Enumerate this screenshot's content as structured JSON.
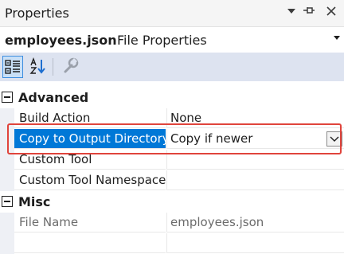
{
  "window": {
    "title": "Properties"
  },
  "object": {
    "name": "employees.json",
    "kind": "File Properties"
  },
  "toolbar": {
    "buttons": [
      {
        "icon": "categorized-icon",
        "active": true
      },
      {
        "icon": "alphabetical-icon",
        "active": false
      },
      {
        "icon": "property-pages-wrench-icon",
        "active": false
      }
    ]
  },
  "categories": {
    "advanced": {
      "label": "Advanced",
      "rows": [
        {
          "name": "Build Action",
          "value": "None"
        },
        {
          "name": "Copy to Output Directory",
          "value": "Copy if newer"
        },
        {
          "name": "Custom Tool",
          "value": ""
        },
        {
          "name": "Custom Tool Namespace",
          "value": ""
        }
      ]
    },
    "misc": {
      "label": "Misc",
      "rows": [
        {
          "name": "File Name",
          "value": "employees.json"
        }
      ]
    }
  },
  "colors": {
    "selection": "#0078d7",
    "highlight_box": "#e0443c",
    "toolbar_bg": "#dde3f0"
  }
}
